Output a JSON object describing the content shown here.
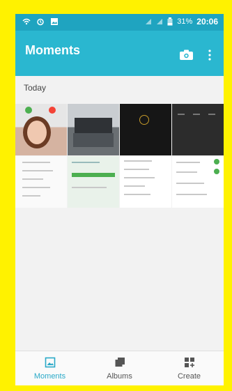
{
  "status_bar": {
    "battery": "31%",
    "time": "20:06"
  },
  "app_bar": {
    "title": "Moments"
  },
  "content": {
    "section_title": "Today"
  },
  "bottom_nav": {
    "items": [
      {
        "label": "Moments",
        "icon": "image-icon"
      },
      {
        "label": "Albums",
        "icon": "albums-icon"
      },
      {
        "label": "Create",
        "icon": "create-icon"
      }
    ]
  },
  "colors": {
    "accent": "#2ab7d0",
    "status_bar": "#1fa4c0",
    "frame": "#fff200"
  }
}
